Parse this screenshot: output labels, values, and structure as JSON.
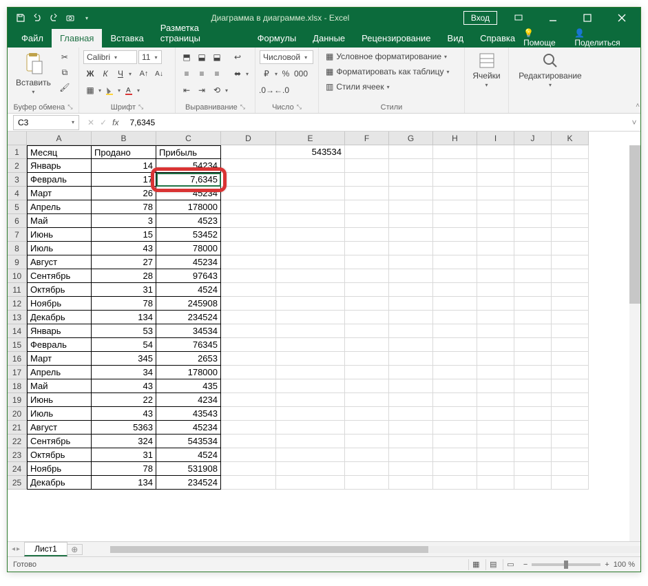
{
  "titlebar": {
    "title": "Диаграмма в диаграмме.xlsx  -  Excel",
    "login": "Вход"
  },
  "tabs": {
    "file": "Файл",
    "items": [
      "Главная",
      "Вставка",
      "Разметка страницы",
      "Формулы",
      "Данные",
      "Рецензирование",
      "Вид",
      "Справка"
    ],
    "active": 0,
    "help": "Помоще",
    "share": "Поделиться"
  },
  "ribbon": {
    "clipboard": {
      "paste": "Вставить",
      "label": "Буфер обмена"
    },
    "font": {
      "name": "Calibri",
      "size": "11",
      "label": "Шрифт"
    },
    "align": {
      "label": "Выравнивание"
    },
    "number": {
      "format": "Числовой",
      "label": "Число"
    },
    "styles": {
      "cond": "Условное форматирование",
      "table": "Форматировать как таблицу",
      "cell": "Стили ячеек",
      "label": "Стили"
    },
    "cells": {
      "label": "Ячейки"
    },
    "editing": {
      "label": "Редактирование"
    }
  },
  "formula": {
    "namebox": "C3",
    "value": "7,6345"
  },
  "cols": [
    "A",
    "B",
    "C",
    "D",
    "E",
    "F",
    "G",
    "H",
    "I",
    "J",
    "K"
  ],
  "rows": [
    {
      "n": 1,
      "a": "Месяц",
      "b": "Продано",
      "c": "Прибыль",
      "e": "543534"
    },
    {
      "n": 2,
      "a": "Январь",
      "b": "14",
      "c": "54234"
    },
    {
      "n": 3,
      "a": "Февраль",
      "b": "17",
      "c": "7,6345"
    },
    {
      "n": 4,
      "a": "Март",
      "b": "26",
      "c": "45234"
    },
    {
      "n": 5,
      "a": "Апрель",
      "b": "78",
      "c": "178000"
    },
    {
      "n": 6,
      "a": "Май",
      "b": "3",
      "c": "4523"
    },
    {
      "n": 7,
      "a": "Июнь",
      "b": "15",
      "c": "53452"
    },
    {
      "n": 8,
      "a": "Июль",
      "b": "43",
      "c": "78000"
    },
    {
      "n": 9,
      "a": "Август",
      "b": "27",
      "c": "45234"
    },
    {
      "n": 10,
      "a": "Сентябрь",
      "b": "28",
      "c": "97643"
    },
    {
      "n": 11,
      "a": "Октябрь",
      "b": "31",
      "c": "4524"
    },
    {
      "n": 12,
      "a": "Ноябрь",
      "b": "78",
      "c": "245908"
    },
    {
      "n": 13,
      "a": "Декабрь",
      "b": "134",
      "c": "234524"
    },
    {
      "n": 14,
      "a": "Январь",
      "b": "53",
      "c": "34534"
    },
    {
      "n": 15,
      "a": "Февраль",
      "b": "54",
      "c": "76345"
    },
    {
      "n": 16,
      "a": "Март",
      "b": "345",
      "c": "2653"
    },
    {
      "n": 17,
      "a": "Апрель",
      "b": "34",
      "c": "178000"
    },
    {
      "n": 18,
      "a": "Май",
      "b": "43",
      "c": "435"
    },
    {
      "n": 19,
      "a": "Июнь",
      "b": "22",
      "c": "4234"
    },
    {
      "n": 20,
      "a": "Июль",
      "b": "43",
      "c": "43543"
    },
    {
      "n": 21,
      "a": "Август",
      "b": "5363",
      "c": "45234"
    },
    {
      "n": 22,
      "a": "Сентябрь",
      "b": "324",
      "c": "543534"
    },
    {
      "n": 23,
      "a": "Октябрь",
      "b": "31",
      "c": "4524"
    },
    {
      "n": 24,
      "a": "Ноябрь",
      "b": "78",
      "c": "531908"
    },
    {
      "n": 25,
      "a": "Декабрь",
      "b": "134",
      "c": "234524"
    }
  ],
  "sheet": {
    "name": "Лист1"
  },
  "status": {
    "ready": "Готово",
    "zoom": "100 %"
  },
  "highlight": {
    "cell": "C3"
  }
}
